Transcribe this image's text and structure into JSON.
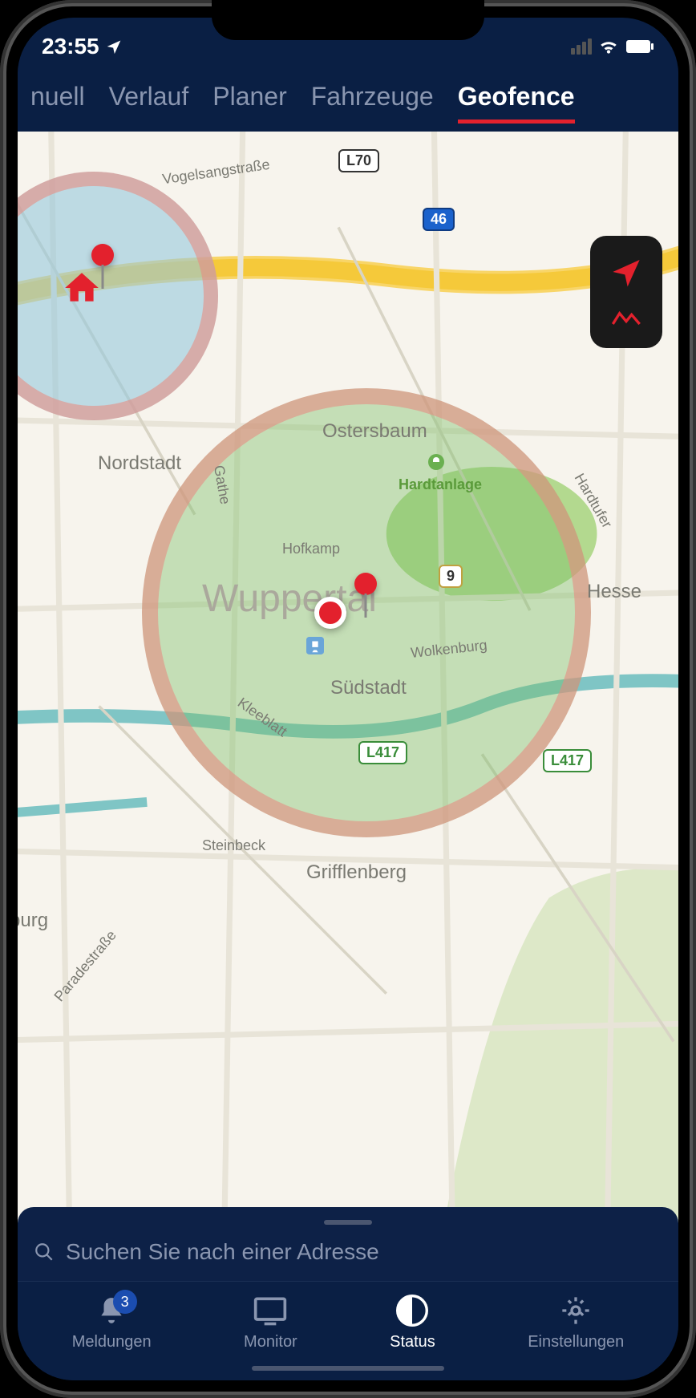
{
  "status": {
    "time": "23:55"
  },
  "tabs": {
    "items": [
      {
        "label": "nuell"
      },
      {
        "label": "Verlauf"
      },
      {
        "label": "Planer"
      },
      {
        "label": "Fahrzeuge"
      },
      {
        "label": "Geofence"
      }
    ],
    "activeIndex": 4
  },
  "map": {
    "city": "Wuppertal",
    "districts": {
      "nordstadt": "Nordstadt",
      "ostersbaum": "Ostersbaum",
      "suedstadt": "Südstadt",
      "grifflenberg": "Grifflenberg",
      "hesse": "Hesse",
      "burgPartial": "burg"
    },
    "park": "Hardtanlage",
    "streets": {
      "vogelsang": "Vogelsangstraße",
      "hofkamp": "Hofkamp",
      "wolkenburg": "Wolkenburg",
      "kleeblatt": "Kleeblatt",
      "steinbeck": "Steinbeck",
      "paradestr": "Paradestraße",
      "gathe": "Gathe",
      "hardtufer": "Hardtufer"
    },
    "shields": {
      "l70": "L70",
      "a46": "46",
      "b9": "9",
      "l417a": "L417",
      "l417b": "L417"
    }
  },
  "search": {
    "placeholder": "Suchen Sie nach einer Adresse"
  },
  "nav": {
    "items": [
      {
        "label": "Meldungen",
        "badge": "3"
      },
      {
        "label": "Monitor"
      },
      {
        "label": "Status"
      },
      {
        "label": "Einstellungen"
      }
    ],
    "activeIndex": 2
  }
}
